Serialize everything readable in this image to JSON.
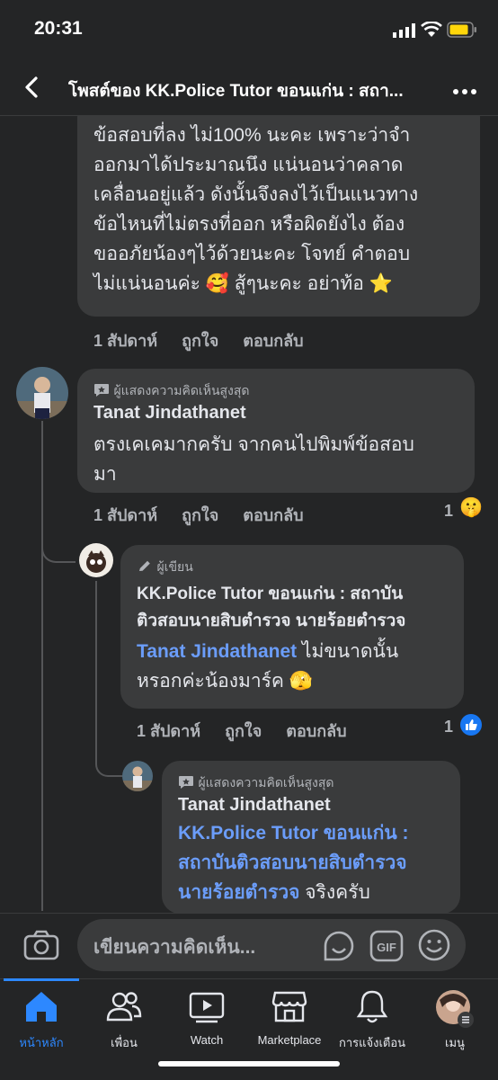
{
  "status": {
    "time": "20:31"
  },
  "header": {
    "title": "โพสต์ของ KK.Police Tutor ขอนแก่น : สถา..."
  },
  "comment1": {
    "lines": [
      "ข้อสอบที่ลง ไม่100% นะคะ เพราะว่าจำ",
      "ออกมาได้ประมาณนึง แน่นอนว่าคลาด",
      "เคลื่อนอยู่แล้ว ดังนั้นจึงลงไว้เป็นแนวทาง",
      "ข้อไหนที่ไม่ตรงที่ออก หรือผิดยังไง ต้อง",
      "ขออภัยน้องๆไว้ด้วยนะคะ โจทย์ คำตอบ",
      "ไม่แน่นอนค่ะ 🥰 สู้ๆนะคะ อย่าท้อ ⭐"
    ],
    "time": "1 สัปดาห์",
    "like": "ถูกใจ",
    "reply": "ตอบกลับ"
  },
  "comment2": {
    "badge": "ผู้แสดงความคิดเห็นสูงสุด",
    "name": "Tanat Jindathanet",
    "lines": [
      "ตรงเคเคมากครับ จากคนไปพิมพ์ข้อสอบ",
      "มา"
    ],
    "time": "1 สัปดาห์",
    "like": "ถูกใจ",
    "reply": "ตอบกลับ",
    "reaction_count": "1",
    "reaction_emoji": "🤫"
  },
  "comment3": {
    "badge": "ผู้เขียน",
    "name_line1": "KK.Police Tutor",
    "name_line1_rest": " ขอนแก่น : สถาบัน",
    "name_line2": "ติวสอบนายสิบตำรวจ นายร้อยตำรวจ",
    "mention": "Tanat Jindathanet",
    "text_after_mention": " ไม่ขนาดนั้น",
    "text_line4": "หรอกค่ะน้องมาร์ค 🫣",
    "time": "1 สัปดาห์",
    "like": "ถูกใจ",
    "reply": "ตอบกลับ",
    "reaction_count": "1"
  },
  "comment4": {
    "badge": "ผู้แสดงความคิดเห็นสูงสุด",
    "name": "Tanat Jindathanet",
    "mention_line1": "KK.Police Tutor ขอนแก่น :",
    "mention_line2": "สถาบันติวสอบนายสิบตำรวจ",
    "mention_line3": "นายร้อยตำรวจ",
    "text_after_mention": " จริงครับ"
  },
  "input": {
    "placeholder": "เขียนความคิดเห็น..."
  },
  "tabs": [
    {
      "label": "หน้าหลัก",
      "icon": "home-icon",
      "active": true
    },
    {
      "label": "เพื่อน",
      "icon": "friends-icon"
    },
    {
      "label": "Watch",
      "icon": "watch-icon"
    },
    {
      "label": "Marketplace",
      "icon": "marketplace-icon"
    },
    {
      "label": "การแจ้งเตือน",
      "icon": "bell-icon"
    },
    {
      "label": "เมนู",
      "icon": "menu-avatar"
    }
  ],
  "colors": {
    "accent": "#2d88ff",
    "link": "#6b9dfa",
    "background": "#242526",
    "bubble": "#3a3b3c"
  }
}
